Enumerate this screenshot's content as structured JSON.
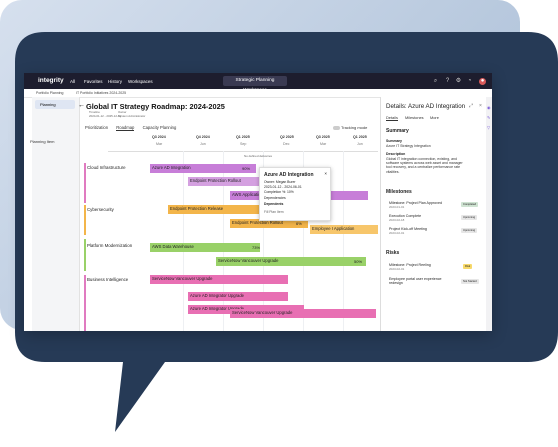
{
  "colors": {
    "accent": "#2d6cdf",
    "pink": "#e07bc0",
    "purple": "#c77ed8",
    "orange": "#f3b54a",
    "green": "#99d168",
    "bg_dark": "#263a56"
  },
  "topbar": {
    "logo": "integrity",
    "nav": [
      "All",
      "Favorites",
      "History",
      "Workspaces"
    ],
    "workspace": "Strategic Planning Workspace"
  },
  "crumbs": {
    "a": "Portfolio Planning",
    "b": "IT Portfolio Initiatives 2024-2025"
  },
  "sidebar": {
    "item": "Planning"
  },
  "main": {
    "title": "Global IT Strategy Roadmap: 2024-2025",
    "meta1": "Timeline",
    "meta2": "2024-01-12 - 2025-12-31",
    "meta3": "Owner",
    "meta4": "System Administrator",
    "tabs": [
      "Prioritization",
      "Roadmap",
      "Capacity Planning"
    ],
    "tracking": "Tracking mode",
    "filter": "Filter",
    "timeline": "Timeline",
    "market": "Market",
    "planning_item": "Planning Item",
    "quarters": [
      "Q3 2024",
      "Q4 2024",
      "Q1 2025",
      "Q2 2025",
      "Q3 2025",
      "Q1 2025",
      "Q2 2025"
    ],
    "months": [
      "Mar",
      "Jun",
      "Sep",
      "Dec",
      "Mar",
      "Jun",
      "Sep"
    ],
    "groups": [
      "Cloud Infrastructure",
      "Cybersecurity",
      "Platform Modernization",
      "Business Intelligence"
    ],
    "no_deliver": "No defined deliveries",
    "bars": {
      "azure": "Azure AD Integration",
      "azure_pct": "90%",
      "endpoint_roll": "Endpoint Protection Rollout",
      "aws_apps": "AWS Applications",
      "endpoint_rel": "Endpoint Protection Release",
      "endpoint_pct": "6%",
      "endpoint_roll2": "Endpoint Protection Rollout",
      "endpoint_pct2": "6%",
      "employee": "Employee I Application",
      "aws_dw": "AWS Data Warehouse",
      "aws_dw_pct": "73%",
      "svc_vancouver": "ServiceNow Vancouver Upgrade",
      "svc_pct": "50%",
      "svc_upgrade": "ServiceNow Vancouver Upgrade",
      "azure_int": "Azure AD Integrator Upgrade",
      "azure_int2": "Azure AD Integrator Upgrade",
      "svc3": "ServiceNow Vancouver Upgrade"
    }
  },
  "popup": {
    "title": "Azure AD Integration",
    "owner": "Owner: Megan Burer",
    "dates": "2023-01-12 - 2024-06-01",
    "completion": "Completion %: 10%",
    "deps": "Dependencies",
    "deps2": "Dependents",
    "link": "Fill Plan Item"
  },
  "details": {
    "header": "Details: Azure AD Integration",
    "tabs": [
      "Details",
      "Milestones",
      "More"
    ],
    "summary_h": "Summary",
    "summary_l": "Summary",
    "summary_v": "Azure IT Strategy Integration",
    "desc_l": "Description",
    "desc_v": "Global IT integration connection, existing, and software systems across web asset and manager tool recovery, and a centralize performance rate vitalities.",
    "milestones_h": "Milestones",
    "milestones": [
      {
        "name": "Milestone: Project Plan Approved",
        "date": "2023-01-01",
        "badge": "Completed"
      },
      {
        "name": "Execution Complete",
        "date": "2023-02-18",
        "badge": "Upcoming"
      },
      {
        "name": "Project Kick-off Meeting",
        "date": "2023-02-01",
        "badge": "Upcoming"
      }
    ],
    "risks_h": "Risks",
    "risks": [
      {
        "name": "Milestone: Project Reeling",
        "date": "2023-02-01",
        "badge": "Risk"
      },
      {
        "name": "Employee portal user experience redesign",
        "date": "",
        "badge": "Not Started"
      }
    ]
  }
}
